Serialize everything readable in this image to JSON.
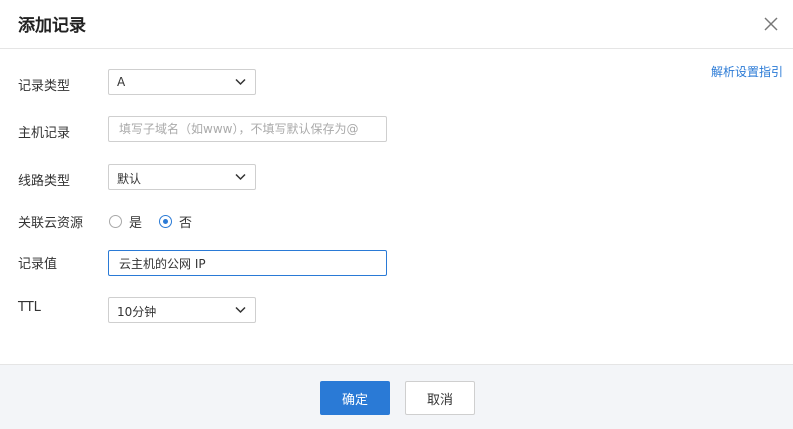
{
  "dialog": {
    "title": "添加记录",
    "guide_link": "解析设置指引"
  },
  "form": {
    "record_type": {
      "label": "记录类型",
      "value": "A"
    },
    "host_record": {
      "label": "主机记录",
      "value": "",
      "placeholder": "填写子域名（如www），不填写默认保存为@"
    },
    "line_type": {
      "label": "线路类型",
      "value": "默认"
    },
    "linked_resource": {
      "label": "关联云资源",
      "options": [
        {
          "label": "是",
          "selected": false
        },
        {
          "label": "否",
          "selected": true
        }
      ]
    },
    "record_value": {
      "label": "记录值",
      "value": "云主机的公网 IP"
    },
    "ttl": {
      "label": "TTL",
      "value": "10分钟"
    }
  },
  "footer": {
    "confirm_label": "确定",
    "cancel_label": "取消"
  },
  "colors": {
    "accent": "#2a7ad6",
    "footer_bg": "#f3f5f8"
  }
}
